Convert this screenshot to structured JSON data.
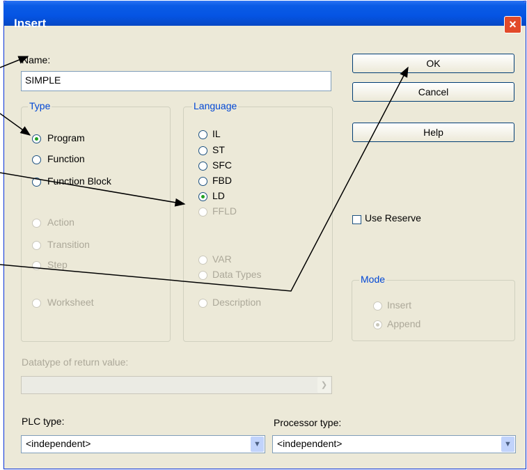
{
  "window": {
    "title": "Insert",
    "close_icon": "×"
  },
  "name": {
    "label": "Name:",
    "value": "SIMPLE"
  },
  "buttons": {
    "ok": "OK",
    "cancel": "Cancel",
    "help": "Help"
  },
  "type_group": {
    "label": "Type",
    "options": [
      {
        "label": "Program",
        "selected": true,
        "enabled": true
      },
      {
        "label": "Function",
        "selected": false,
        "enabled": true
      },
      {
        "label": "Function Block",
        "selected": false,
        "enabled": true
      },
      {
        "label": "Action",
        "selected": false,
        "enabled": false
      },
      {
        "label": "Transition",
        "selected": false,
        "enabled": false
      },
      {
        "label": "Step",
        "selected": false,
        "enabled": false
      },
      {
        "label": "Worksheet",
        "selected": false,
        "enabled": false
      }
    ]
  },
  "language_group": {
    "label": "Language",
    "options": [
      {
        "label": "IL",
        "selected": false,
        "enabled": true
      },
      {
        "label": "ST",
        "selected": false,
        "enabled": true
      },
      {
        "label": "SFC",
        "selected": false,
        "enabled": true
      },
      {
        "label": "FBD",
        "selected": false,
        "enabled": true
      },
      {
        "label": "LD",
        "selected": true,
        "enabled": true
      },
      {
        "label": "FFLD",
        "selected": false,
        "enabled": false
      },
      {
        "label": "VAR",
        "selected": false,
        "enabled": false
      },
      {
        "label": "Data Types",
        "selected": false,
        "enabled": false
      },
      {
        "label": "Description",
        "selected": false,
        "enabled": false
      }
    ]
  },
  "use_reserve": {
    "label": "Use Reserve",
    "checked": false
  },
  "mode_group": {
    "label": "Mode",
    "options": [
      {
        "label": "Insert",
        "selected": false,
        "enabled": false
      },
      {
        "label": "Append",
        "selected": true,
        "enabled": false
      }
    ]
  },
  "return_type": {
    "label": "Datatype of return value:",
    "value": ""
  },
  "plc_type": {
    "label": "PLC type:",
    "value": "<independent>"
  },
  "processor_type": {
    "label": "Processor type:",
    "value": "<independent>"
  },
  "colors": {
    "title_bar": "#0554e3",
    "dialog_bg": "#ece9d8",
    "group_label": "#0046d5",
    "radio_dot": "#21a121"
  }
}
